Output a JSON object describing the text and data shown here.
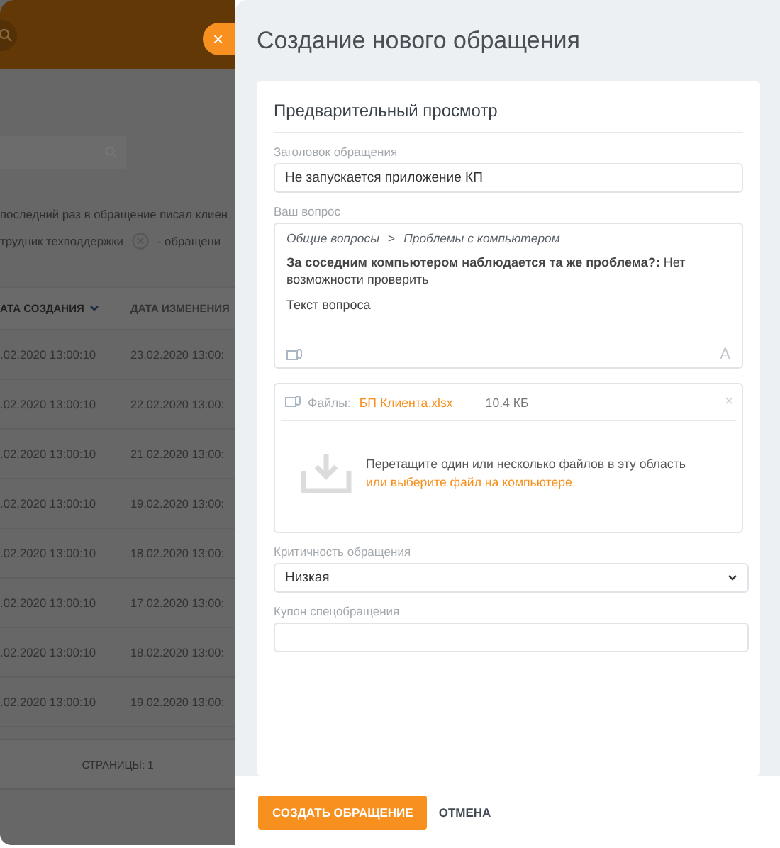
{
  "background": {
    "close_button": "×",
    "legend": {
      "line_1": "последний раз в обращение писал клиен",
      "line_2": "трудник техподдержки",
      "line_2_after": "- обращени"
    },
    "table": {
      "columns": [
        {
          "label": "АТА СОЗДАНИЯ",
          "sorted": true
        },
        {
          "label": "ДАТА ИЗМЕНЕНИЯ",
          "sorted": false
        }
      ],
      "rows": [
        [
          ".02.2020 13:00:10",
          "23.02.2020 13:00:"
        ],
        [
          ".02.2020 13:00:10",
          "22.02.2020 13:00:"
        ],
        [
          ".02.2020 13:00:10",
          "21.02.2020 13:00:"
        ],
        [
          ".02.2020 13:00:10",
          "19.02.2020 13:00:"
        ],
        [
          ".02.2020 13:00:10",
          "18.02.2020 13:00:"
        ],
        [
          ".02.2020 13:00:10",
          "17.02.2020 13:00:"
        ],
        [
          ".02.2020 13:00:10",
          "18.02.2020 13:00:"
        ],
        [
          ".02.2020 13:00:10",
          "19.02.2020 13:00:"
        ]
      ]
    },
    "pager": "СТРАНИЦЫ: 1"
  },
  "panel": {
    "title": "Создание нового обращения",
    "card_title": "Предварительный просмотр",
    "subject": {
      "label": "Заголовок обращения",
      "value": "Не запускается приложение КП"
    },
    "question": {
      "label": "Ваш вопрос",
      "breadcrumb": [
        "Общие вопросы",
        "Проблемы с компьютером"
      ],
      "separator": ">",
      "answer": "**За соседним компьютером наблюдается та же проблема?:** Нет возможности проверить",
      "text": "Текст вопроса",
      "format_glyph": "A"
    },
    "files": {
      "label": "Файлы:",
      "file_name": "БП Клиента.xlsx",
      "file_size": "10.4 КБ",
      "remove": "×",
      "drop_text": "Перетащите один или несколько файлов в эту область",
      "drop_link": "или выберите файл на компьютере"
    },
    "priority": {
      "label": "Критичность обращения",
      "value": "Низкая"
    },
    "coupon": {
      "label": "Купон спецобращения"
    },
    "buttons": {
      "submit": "СОЗДАТЬ ОБРАЩЕНИЕ",
      "cancel": "ОТМЕНА"
    }
  }
}
